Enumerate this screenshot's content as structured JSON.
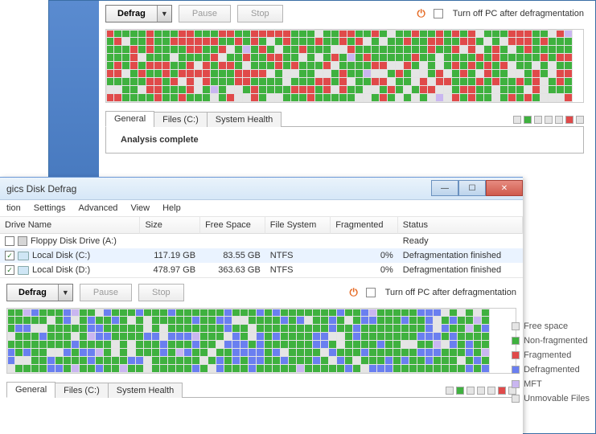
{
  "back": {
    "defrag_label": "Defrag",
    "pause_label": "Pause",
    "stop_label": "Stop",
    "turnoff_label": "Turn off PC after defragmentation",
    "tabs": [
      "General",
      "Files (C:)",
      "System Health"
    ],
    "analysis": "Analysis complete",
    "map_cols": 58,
    "map_rows": 9,
    "map_seed": 17,
    "map_palette": "gr"
  },
  "front": {
    "title": "gics Disk Defrag",
    "menu": [
      "tion",
      "Settings",
      "Advanced",
      "View",
      "Help"
    ],
    "columns": [
      "Drive Name",
      "Size",
      "Free Space",
      "File System",
      "Fragmented",
      "Status"
    ],
    "rows": [
      {
        "checked": false,
        "icon": "floppy",
        "name": "Floppy Disk Drive (A:)",
        "size": "",
        "free": "",
        "fs": "",
        "frag": "",
        "status": "Ready",
        "status_link": false
      },
      {
        "checked": true,
        "icon": "hdd",
        "name": "Local Disk (C:)",
        "size": "117.19 GB",
        "free": "83.55 GB",
        "fs": "NTFS",
        "frag": "0%",
        "status": "Defragmentation finished",
        "status_link": true,
        "selected": true
      },
      {
        "checked": true,
        "icon": "hdd",
        "name": "Local Disk (D:)",
        "size": "478.97 GB",
        "free": "363.63 GB",
        "fs": "NTFS",
        "frag": "0%",
        "status": "Defragmentation finished",
        "status_link": true
      }
    ],
    "defrag_label": "Defrag",
    "pause_label": "Pause",
    "stop_label": "Stop",
    "turnoff_label": "Turn off PC after defragmentation",
    "tabs": [
      "General",
      "Files (C:)",
      "System Health"
    ],
    "map_cols": 60,
    "map_rows": 8,
    "map_seed": 42,
    "map_palette": "gb"
  },
  "legend": {
    "items": [
      {
        "label": "Free space",
        "class": "w"
      },
      {
        "label": "Non-fragmented",
        "class": "g"
      },
      {
        "label": "Fragmented",
        "class": "r"
      },
      {
        "label": "Defragmented",
        "class": "b"
      },
      {
        "label": "MFT",
        "class": "p"
      },
      {
        "label": "Unmovable Files",
        "class": "w"
      }
    ]
  },
  "legend_colors": [
    "w",
    "g",
    "w",
    "w",
    "w",
    "r",
    "w"
  ],
  "legend_colors_front": [
    "w",
    "g",
    "w",
    "w",
    "w",
    "r",
    "w"
  ]
}
